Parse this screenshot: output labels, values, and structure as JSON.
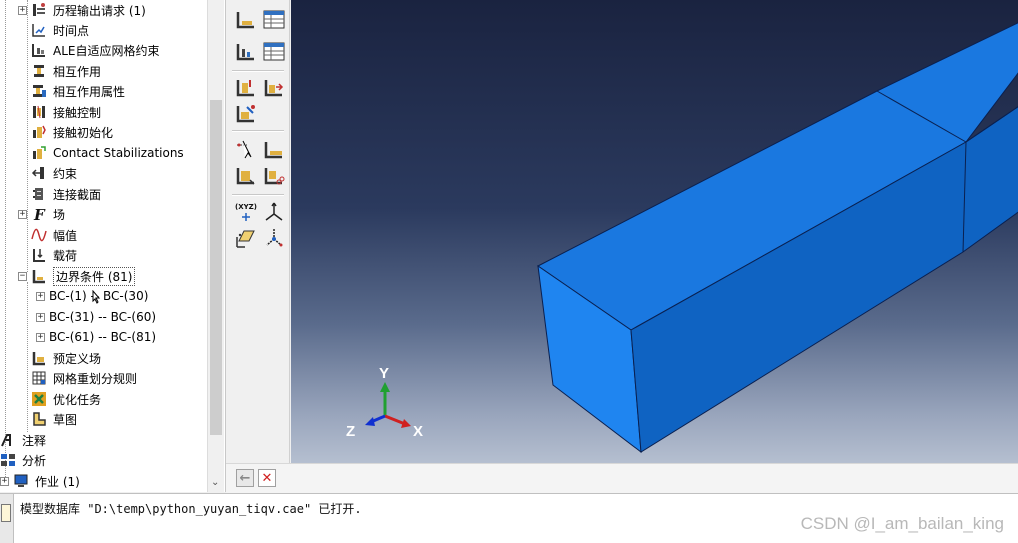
{
  "tree": {
    "items": [
      {
        "label": "历程输出请求 (1)",
        "expander": "+",
        "icon": "history-output-icon"
      },
      {
        "label": "时间点",
        "expander": "",
        "icon": "time-points-icon"
      },
      {
        "label": "ALE自适应网格约束",
        "expander": "",
        "icon": "ale-mesh-constraint-icon"
      },
      {
        "label": "相互作用",
        "expander": "",
        "icon": "interaction-icon"
      },
      {
        "label": "相互作用属性",
        "expander": "",
        "icon": "interaction-property-icon"
      },
      {
        "label": "接触控制",
        "expander": "",
        "icon": "contact-control-icon"
      },
      {
        "label": "接触初始化",
        "expander": "",
        "icon": "contact-initialization-icon"
      },
      {
        "label": "Contact Stabilizations",
        "expander": "",
        "icon": "contact-stabilization-icon"
      },
      {
        "label": "约束",
        "expander": "",
        "icon": "constraint-icon"
      },
      {
        "label": "连接截面",
        "expander": "",
        "icon": "connector-section-icon"
      },
      {
        "label": "场",
        "expander": "+",
        "icon": "field-icon"
      },
      {
        "label": "幅值",
        "expander": "",
        "icon": "amplitude-icon"
      },
      {
        "label": "载荷",
        "expander": "",
        "icon": "load-icon"
      },
      {
        "label": "边界条件 (81)",
        "expander": "−",
        "icon": "boundary-condition-icon"
      },
      {
        "label": "BC-(1) -- BC-(30)",
        "expander": "+",
        "icon": ""
      },
      {
        "label": "BC-(31) -- BC-(60)",
        "expander": "+",
        "icon": ""
      },
      {
        "label": "BC-(61) -- BC-(81)",
        "expander": "+",
        "icon": ""
      },
      {
        "label": "预定义场",
        "expander": "",
        "icon": "predefined-field-icon"
      },
      {
        "label": "网格重划分规则",
        "expander": "",
        "icon": "remeshing-rule-icon"
      },
      {
        "label": "优化任务",
        "expander": "",
        "icon": "optimization-task-icon"
      },
      {
        "label": "草图",
        "expander": "",
        "icon": "sketch-icon"
      },
      {
        "label": "注释",
        "expander": "",
        "icon": "annotation-icon"
      },
      {
        "label": "分析",
        "expander": "",
        "icon": "analysis-icon"
      },
      {
        "label": "作业 (1)",
        "expander": "+",
        "icon": "job-icon"
      }
    ]
  },
  "toolbox": {
    "xyz_label": "(XYZ)"
  },
  "viewport": {
    "triad": {
      "x": "X",
      "y": "Y",
      "z": "Z"
    }
  },
  "prompt": {
    "back_glyph": "←",
    "cancel_glyph": "✕"
  },
  "message": {
    "text": "模型数据库 \"D:\\temp\\python_yuyan_tiqv.cae\" 已打开.",
    "watermark": "CSDN @I_am_bailan_king"
  },
  "colors": {
    "part_top": "#1a78e0",
    "part_front": "#0f63c2",
    "part_side": "#1f85f0",
    "accent_red": "#d02020"
  }
}
